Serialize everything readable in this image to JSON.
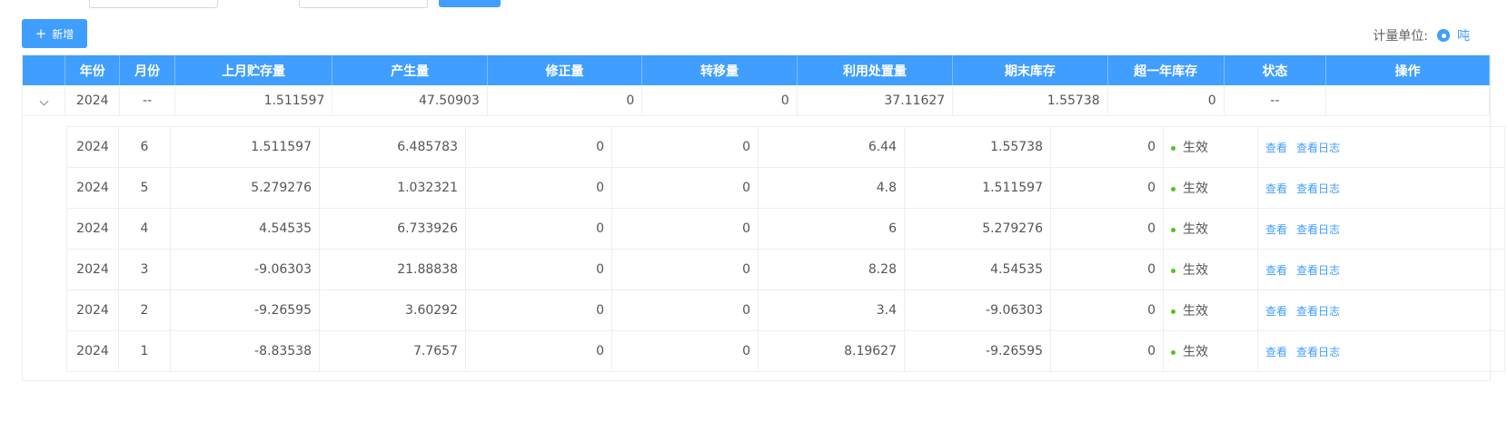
{
  "toolbar": {
    "add_label": "新增",
    "unit_label": "计量单位:",
    "unit_option": "吨"
  },
  "table": {
    "columns": [
      "年份",
      "月份",
      "上月贮存量",
      "产生量",
      "修正量",
      "转移量",
      "利用处置量",
      "期末库存",
      "超一年库存",
      "状态",
      "操作"
    ],
    "summary": {
      "year": "2024",
      "month": "--",
      "prev": "1.511597",
      "gen": "47.50903",
      "adj": "0",
      "trans": "0",
      "use": "37.11627",
      "end": "1.55738",
      "over": "0",
      "status": "--"
    },
    "rows": [
      {
        "year": "2024",
        "month": "6",
        "prev": "1.511597",
        "gen": "6.485783",
        "adj": "0",
        "trans": "0",
        "use": "6.44",
        "end": "1.55738",
        "over": "0",
        "status": "生效"
      },
      {
        "year": "2024",
        "month": "5",
        "prev": "5.279276",
        "gen": "1.032321",
        "adj": "0",
        "trans": "0",
        "use": "4.8",
        "end": "1.511597",
        "over": "0",
        "status": "生效"
      },
      {
        "year": "2024",
        "month": "4",
        "prev": "4.54535",
        "gen": "6.733926",
        "adj": "0",
        "trans": "0",
        "use": "6",
        "end": "5.279276",
        "over": "0",
        "status": "生效"
      },
      {
        "year": "2024",
        "month": "3",
        "prev": "-9.06303",
        "gen": "21.88838",
        "adj": "0",
        "trans": "0",
        "use": "8.28",
        "end": "4.54535",
        "over": "0",
        "status": "生效"
      },
      {
        "year": "2024",
        "month": "2",
        "prev": "-9.26595",
        "gen": "3.60292",
        "adj": "0",
        "trans": "0",
        "use": "3.4",
        "end": "-9.06303",
        "over": "0",
        "status": "生效"
      },
      {
        "year": "2024",
        "month": "1",
        "prev": "-8.83538",
        "gen": "7.7657",
        "adj": "0",
        "trans": "0",
        "use": "8.19627",
        "end": "-9.26595",
        "over": "0",
        "status": "生效"
      }
    ],
    "actions": {
      "view": "查看",
      "view_log": "查看日志"
    }
  },
  "colors": {
    "accent": "#409eff",
    "status_active": "#52c41a"
  }
}
